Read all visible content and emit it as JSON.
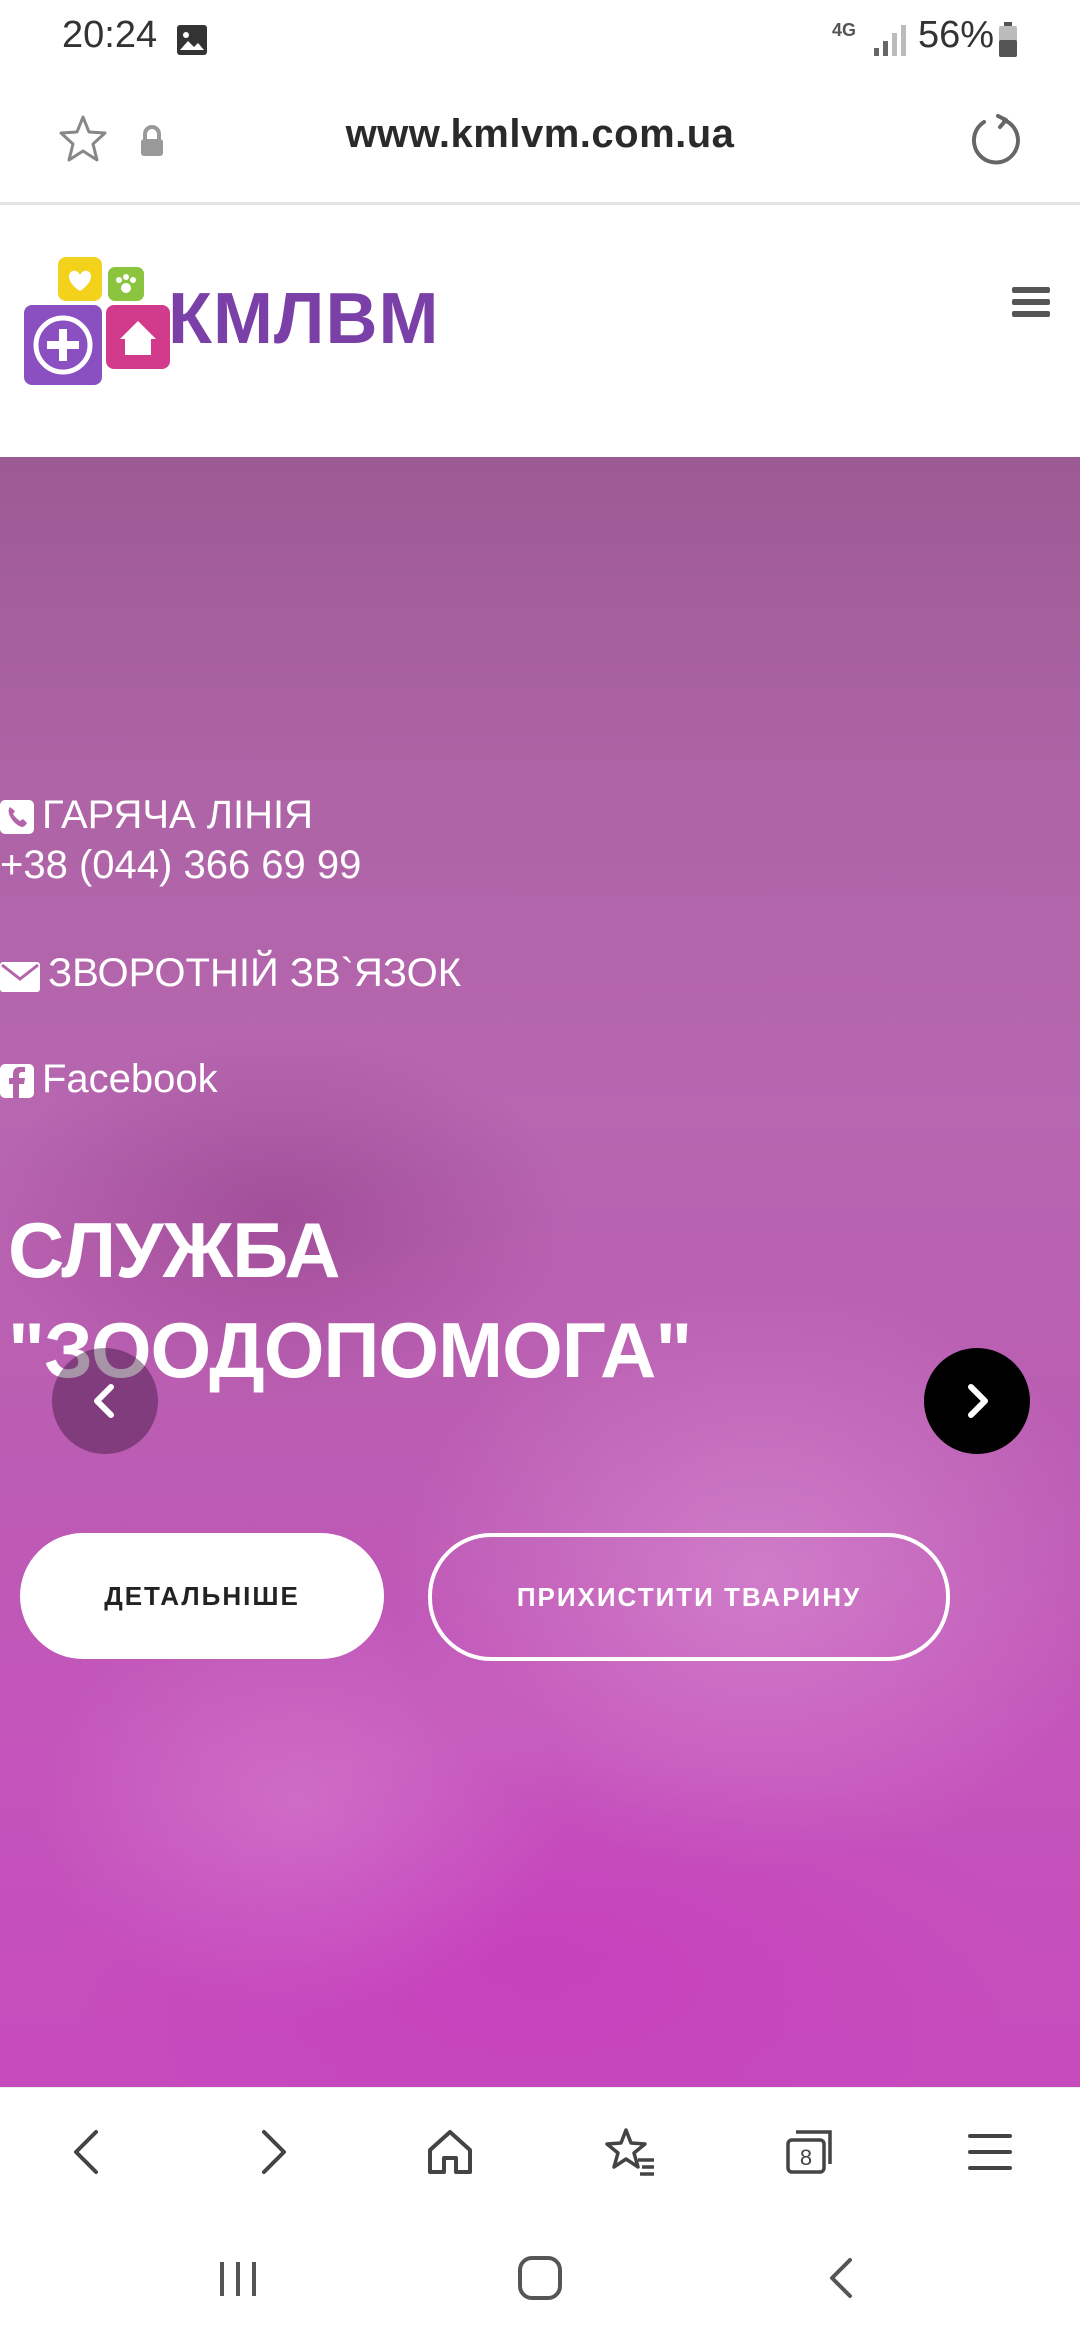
{
  "status_bar": {
    "time": "20:24",
    "network": "4G",
    "battery": "56%",
    "icons": [
      "gallery-icon",
      "signal-icon",
      "battery-icon"
    ]
  },
  "browser": {
    "url": "www.kmlvm.com.ua",
    "icons": [
      "star-icon",
      "lock-icon",
      "reload-icon"
    ]
  },
  "site": {
    "logo_text": "КМЛВМ",
    "menu_icon": "hamburger-icon"
  },
  "hero": {
    "hotline_label": "ГАРЯЧА ЛІНІЯ",
    "hotline_phone": "+38 (044) 366 69 99",
    "feedback_label": "ЗВОРОТНІЙ ЗВ`ЯЗОК",
    "facebook_label": "Facebook",
    "title_line1": "СЛУЖБА",
    "title_line2": "\"ЗООДОПОМОГА\"",
    "details_button": "ДЕТАЛЬНІШЕ",
    "protect_button": "ПРИХИСТИТИ ТВАРИНУ"
  },
  "toolbar": {
    "tabs_count": "8",
    "icons": [
      "back-icon",
      "forward-icon",
      "home-icon",
      "bookmarks-icon",
      "tabs-icon",
      "menu-icon"
    ]
  },
  "system_nav": {
    "icons": [
      "recents-icon",
      "home-button-icon",
      "back-nav-icon"
    ]
  },
  "colors": {
    "brand_purple": "#7b3fa8",
    "hero_magenta": "#c04fb7",
    "logo_yellow": "#f2d21b",
    "logo_green": "#8bc53f",
    "logo_pink": "#d23a8c"
  }
}
